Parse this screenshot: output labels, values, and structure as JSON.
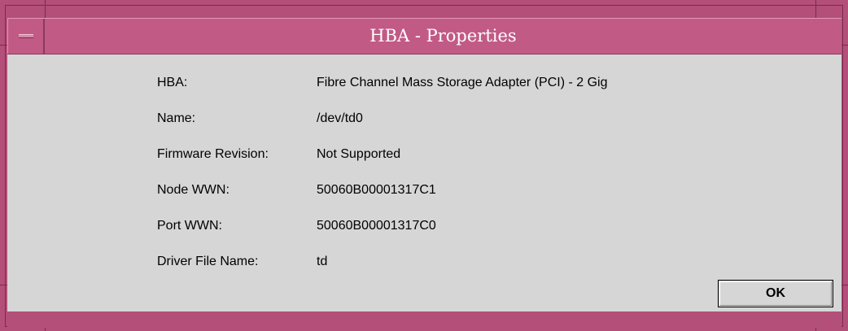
{
  "window": {
    "title": "HBA - Properties",
    "frame_color": "#b34f79",
    "titlebar_color": "#c25a86",
    "content_color": "#d6d6d6"
  },
  "properties": [
    {
      "label": "HBA:",
      "value": "Fibre Channel Mass Storage Adapter (PCI) - 2 Gig"
    },
    {
      "label": "Name:",
      "value": "/dev/td0"
    },
    {
      "label": "Firmware Revision:",
      "value": "Not Supported"
    },
    {
      "label": "Node WWN:",
      "value": "50060B00001317C1"
    },
    {
      "label": "Port WWN:",
      "value": "50060B00001317C0"
    },
    {
      "label": "Driver File Name:",
      "value": "td"
    }
  ],
  "buttons": {
    "ok_label": "OK"
  },
  "icons": {
    "window_menu": "window-menu-icon"
  }
}
